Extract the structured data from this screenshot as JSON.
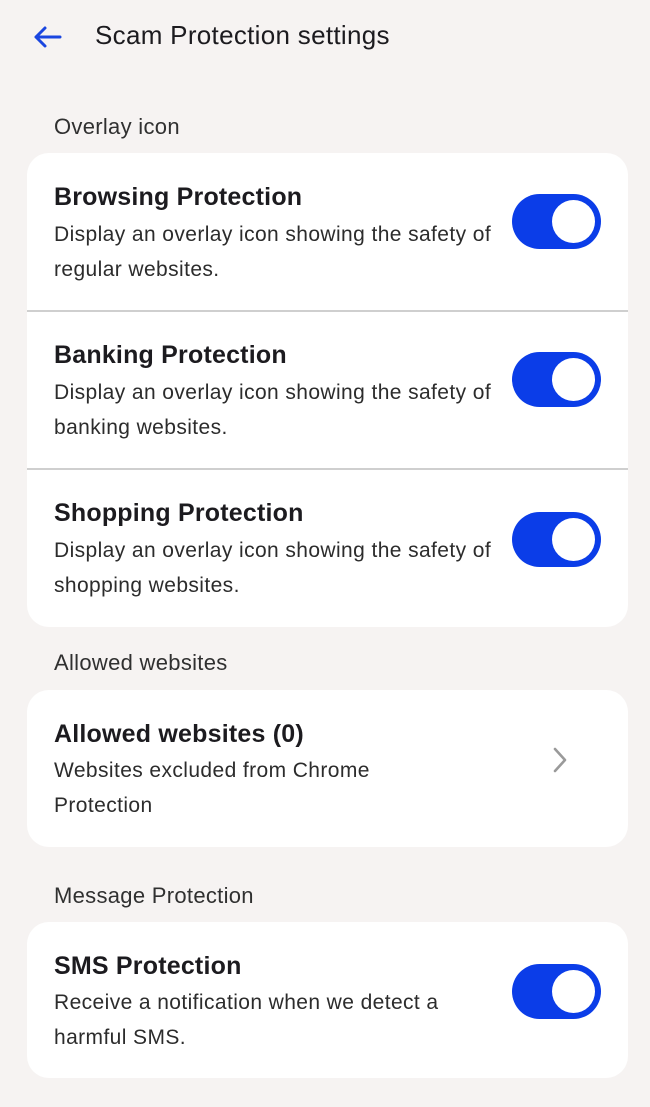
{
  "appbar": {
    "back_icon": "arrow-left-icon",
    "title": "Scam Protection settings"
  },
  "sections": {
    "overlay": {
      "label": "Overlay icon",
      "items": [
        {
          "title": "Browsing Protection",
          "description": "Display an overlay icon showing the safety of regular websites.",
          "enabled": true
        },
        {
          "title": "Banking Protection",
          "description": "Display an overlay icon showing the safety of banking websites.",
          "enabled": true
        },
        {
          "title": "Shopping Protection",
          "description": "Display an overlay icon showing the safety of shopping websites.",
          "enabled": true
        }
      ]
    },
    "allowed": {
      "label": "Allowed websites",
      "item": {
        "title": "Allowed websites (0)",
        "description": "Websites excluded from Chrome Protection",
        "icon": "chevron-right-icon"
      }
    },
    "message": {
      "label": "Message Protection",
      "item": {
        "title": "SMS Protection",
        "description": "Receive a notification when we detect a harmful SMS.",
        "enabled": true
      }
    }
  },
  "colors": {
    "accent": "#0b3de8",
    "background": "#f6f3f2",
    "card": "#ffffff"
  }
}
